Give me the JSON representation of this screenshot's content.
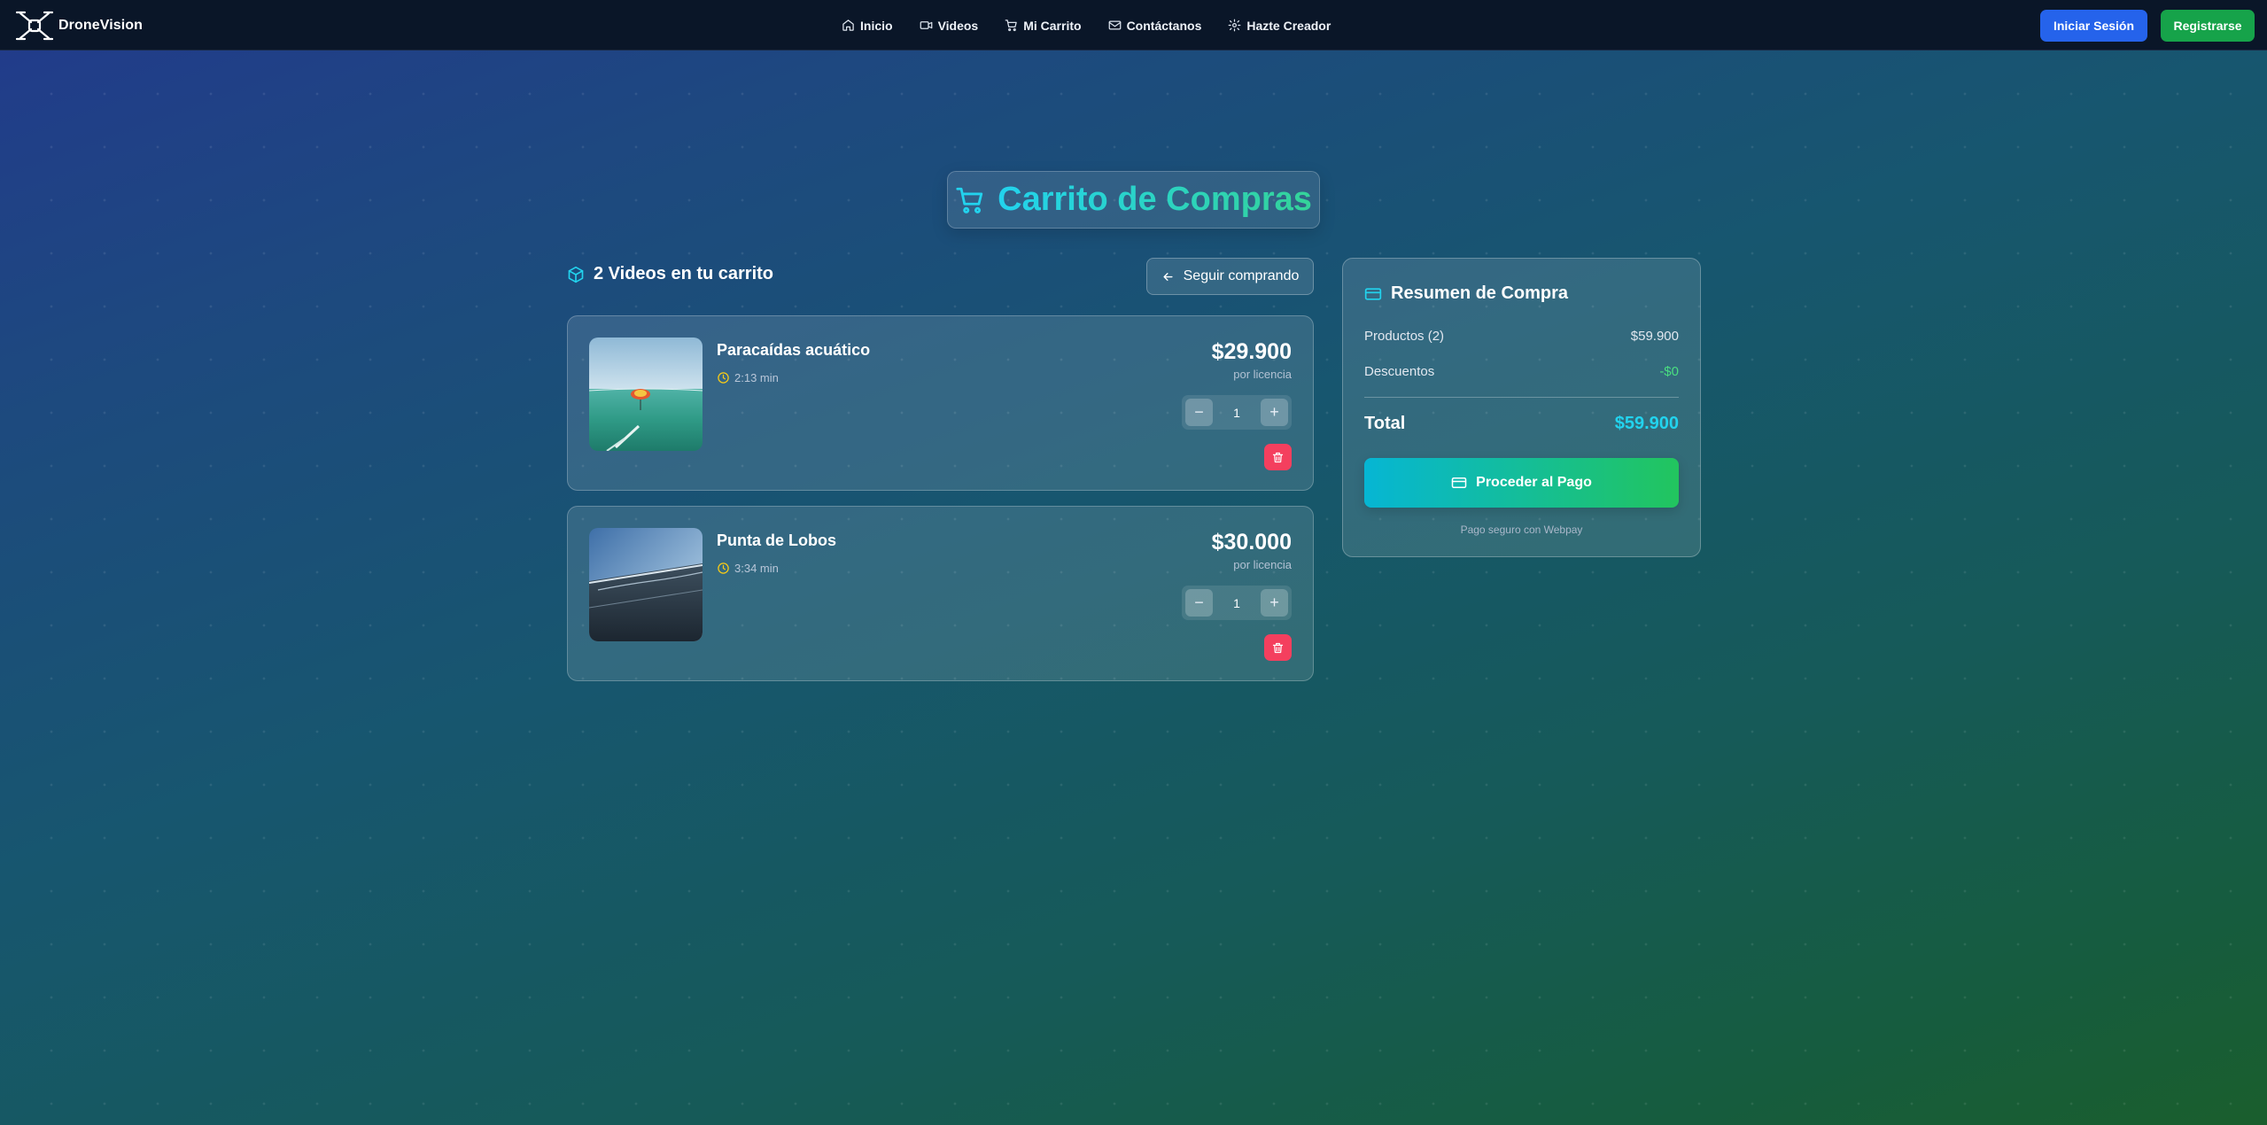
{
  "nav": {
    "brand": "DroneVision",
    "links": [
      {
        "label": "Inicio",
        "icon": "home-icon"
      },
      {
        "label": "Videos",
        "icon": "video-icon"
      },
      {
        "label": "Mi Carrito",
        "icon": "cart-icon"
      },
      {
        "label": "Contáctanos",
        "icon": "mail-icon"
      },
      {
        "label": "Hazte Creador",
        "icon": "gear-icon"
      }
    ],
    "login": "Iniciar Sesión",
    "register": "Registrarse"
  },
  "page": {
    "title": "Carrito de Compras",
    "count_label": "2 Videos en tu carrito",
    "continue_label": "Seguir comprando"
  },
  "cart": {
    "items": [
      {
        "title": "Paracaídas acuático",
        "duration": "2:13 min",
        "price": "$29.900",
        "per": "por licencia",
        "qty": "1"
      },
      {
        "title": "Punta de Lobos",
        "duration": "3:34 min",
        "price": "$30.000",
        "per": "por licencia",
        "qty": "1"
      }
    ]
  },
  "summary": {
    "title": "Resumen de Compra",
    "products_label": "Productos (2)",
    "products_value": "$59.900",
    "discount_label": "Descuentos",
    "discount_value": "-$0",
    "total_label": "Total",
    "total_value": "$59.900",
    "pay_label": "Proceder al Pago",
    "secure_note": "Pago seguro con Webpay"
  },
  "colors": {
    "accent": "#22d3ee",
    "discount": "#4ade80",
    "login_button": "#2563eb",
    "register_button": "#16a34a",
    "delete_button": "#f43f5e",
    "duration_icon": "#facc15"
  }
}
